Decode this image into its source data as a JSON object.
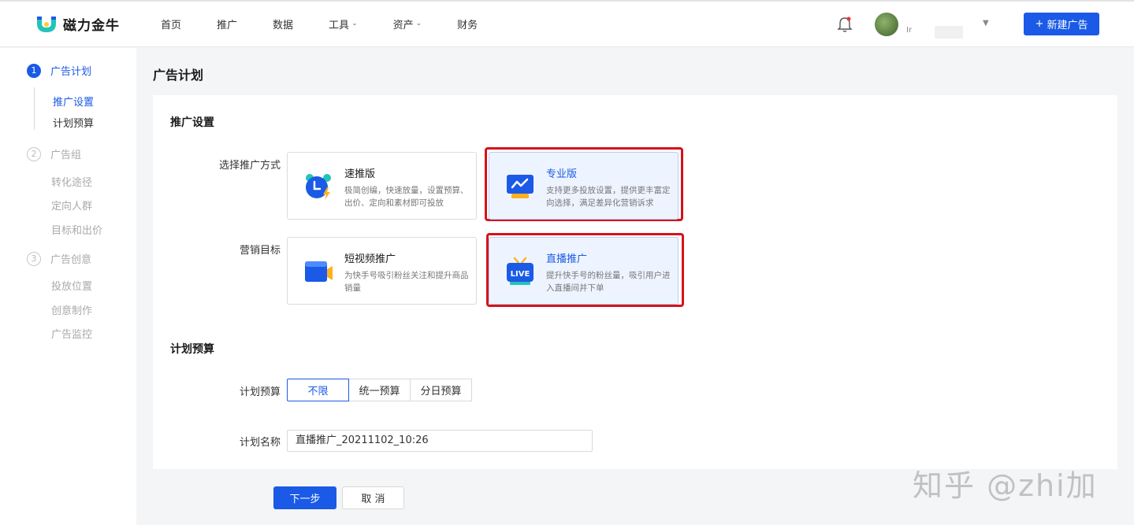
{
  "header": {
    "logo_text": "磁力金牛",
    "nav": [
      {
        "label": "首页",
        "dropdown": false
      },
      {
        "label": "推广",
        "dropdown": false
      },
      {
        "label": "数据",
        "dropdown": false
      },
      {
        "label": "工具",
        "dropdown": true
      },
      {
        "label": "资产",
        "dropdown": true
      },
      {
        "label": "财务",
        "dropdown": false
      }
    ],
    "user_name": "Ir",
    "new_ad_button": "新建广告"
  },
  "sidebar": {
    "step1": {
      "num": "1",
      "label": "广告计划",
      "subs": [
        "推广设置",
        "计划预算"
      ]
    },
    "step2": {
      "num": "2",
      "label": "广告组",
      "subs": [
        "转化途径",
        "定向人群",
        "目标和出价"
      ]
    },
    "step3": {
      "num": "3",
      "label": "广告创意",
      "subs": [
        "投放位置",
        "创意制作",
        "广告监控"
      ]
    }
  },
  "main": {
    "page_title": "广告计划",
    "promo_section_title": "推广设置",
    "method_label": "选择推广方式",
    "goal_label": "营销目标",
    "options": {
      "fast": {
        "title": "速推版",
        "desc": "极简创编，快速放量，设置预算、出价、定向和素材即可投放"
      },
      "pro": {
        "title": "专业版",
        "desc": "支持更多投放设置，提供更丰富定向选择，满足差异化营销诉求"
      },
      "video": {
        "title": "短视频推广",
        "desc": "为快手号吸引粉丝关注和提升商品销量"
      },
      "live": {
        "title": "直播推广",
        "desc": "提升快手号的粉丝量，吸引用户进入直播间并下单",
        "icon_text": "LIVE"
      }
    },
    "budget_section_title": "计划预算",
    "budget_label": "计划预算",
    "budget_options": [
      "不限",
      "统一预算",
      "分日预算"
    ],
    "budget_selected": "不限",
    "name_label": "计划名称",
    "name_value": "直播推广_20211102_10:26",
    "next_button": "下一步",
    "cancel_button": "取 消"
  },
  "watermark": "知乎 @zhi加",
  "colors": {
    "accent": "#1a5ae6",
    "highlight": "#d7121b"
  }
}
